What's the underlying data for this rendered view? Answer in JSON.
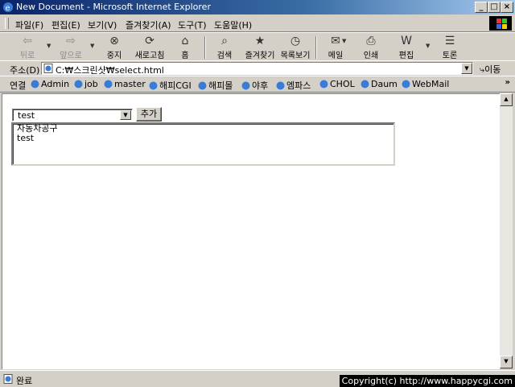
{
  "window": {
    "title": "New Document - Microsoft Internet Explorer",
    "min": "_",
    "max": "□",
    "close": "×"
  },
  "menu": [
    "파일(F)",
    "편집(E)",
    "보기(V)",
    "즐겨찾기(A)",
    "도구(T)",
    "도움말(H)"
  ],
  "toolbar": {
    "back": "뒤로",
    "forward": "앞으로",
    "stop": "중지",
    "refresh": "새로고침",
    "home": "홈",
    "search": "검색",
    "favorites": "즐겨찾기",
    "history": "목록보기",
    "mail": "메일",
    "print": "인쇄",
    "edit": "편집",
    "discuss": "토론"
  },
  "address": {
    "label": "주소(D)",
    "value": "C:₩스크린샷₩select.html",
    "go": "이동"
  },
  "links": {
    "label": "연결",
    "items": [
      "Admin",
      "job",
      "master",
      "해피CGI",
      "해피몰",
      "야후",
      "엠파스",
      "CHOL",
      "Daum",
      "WebMail"
    ]
  },
  "form": {
    "select_value": "test",
    "add_button": "추가",
    "textarea_lines": [
      "자동차공구",
      "test"
    ]
  },
  "status": {
    "text": "완료",
    "copyright": "Copyright(c) http://www.happycgi.com"
  }
}
